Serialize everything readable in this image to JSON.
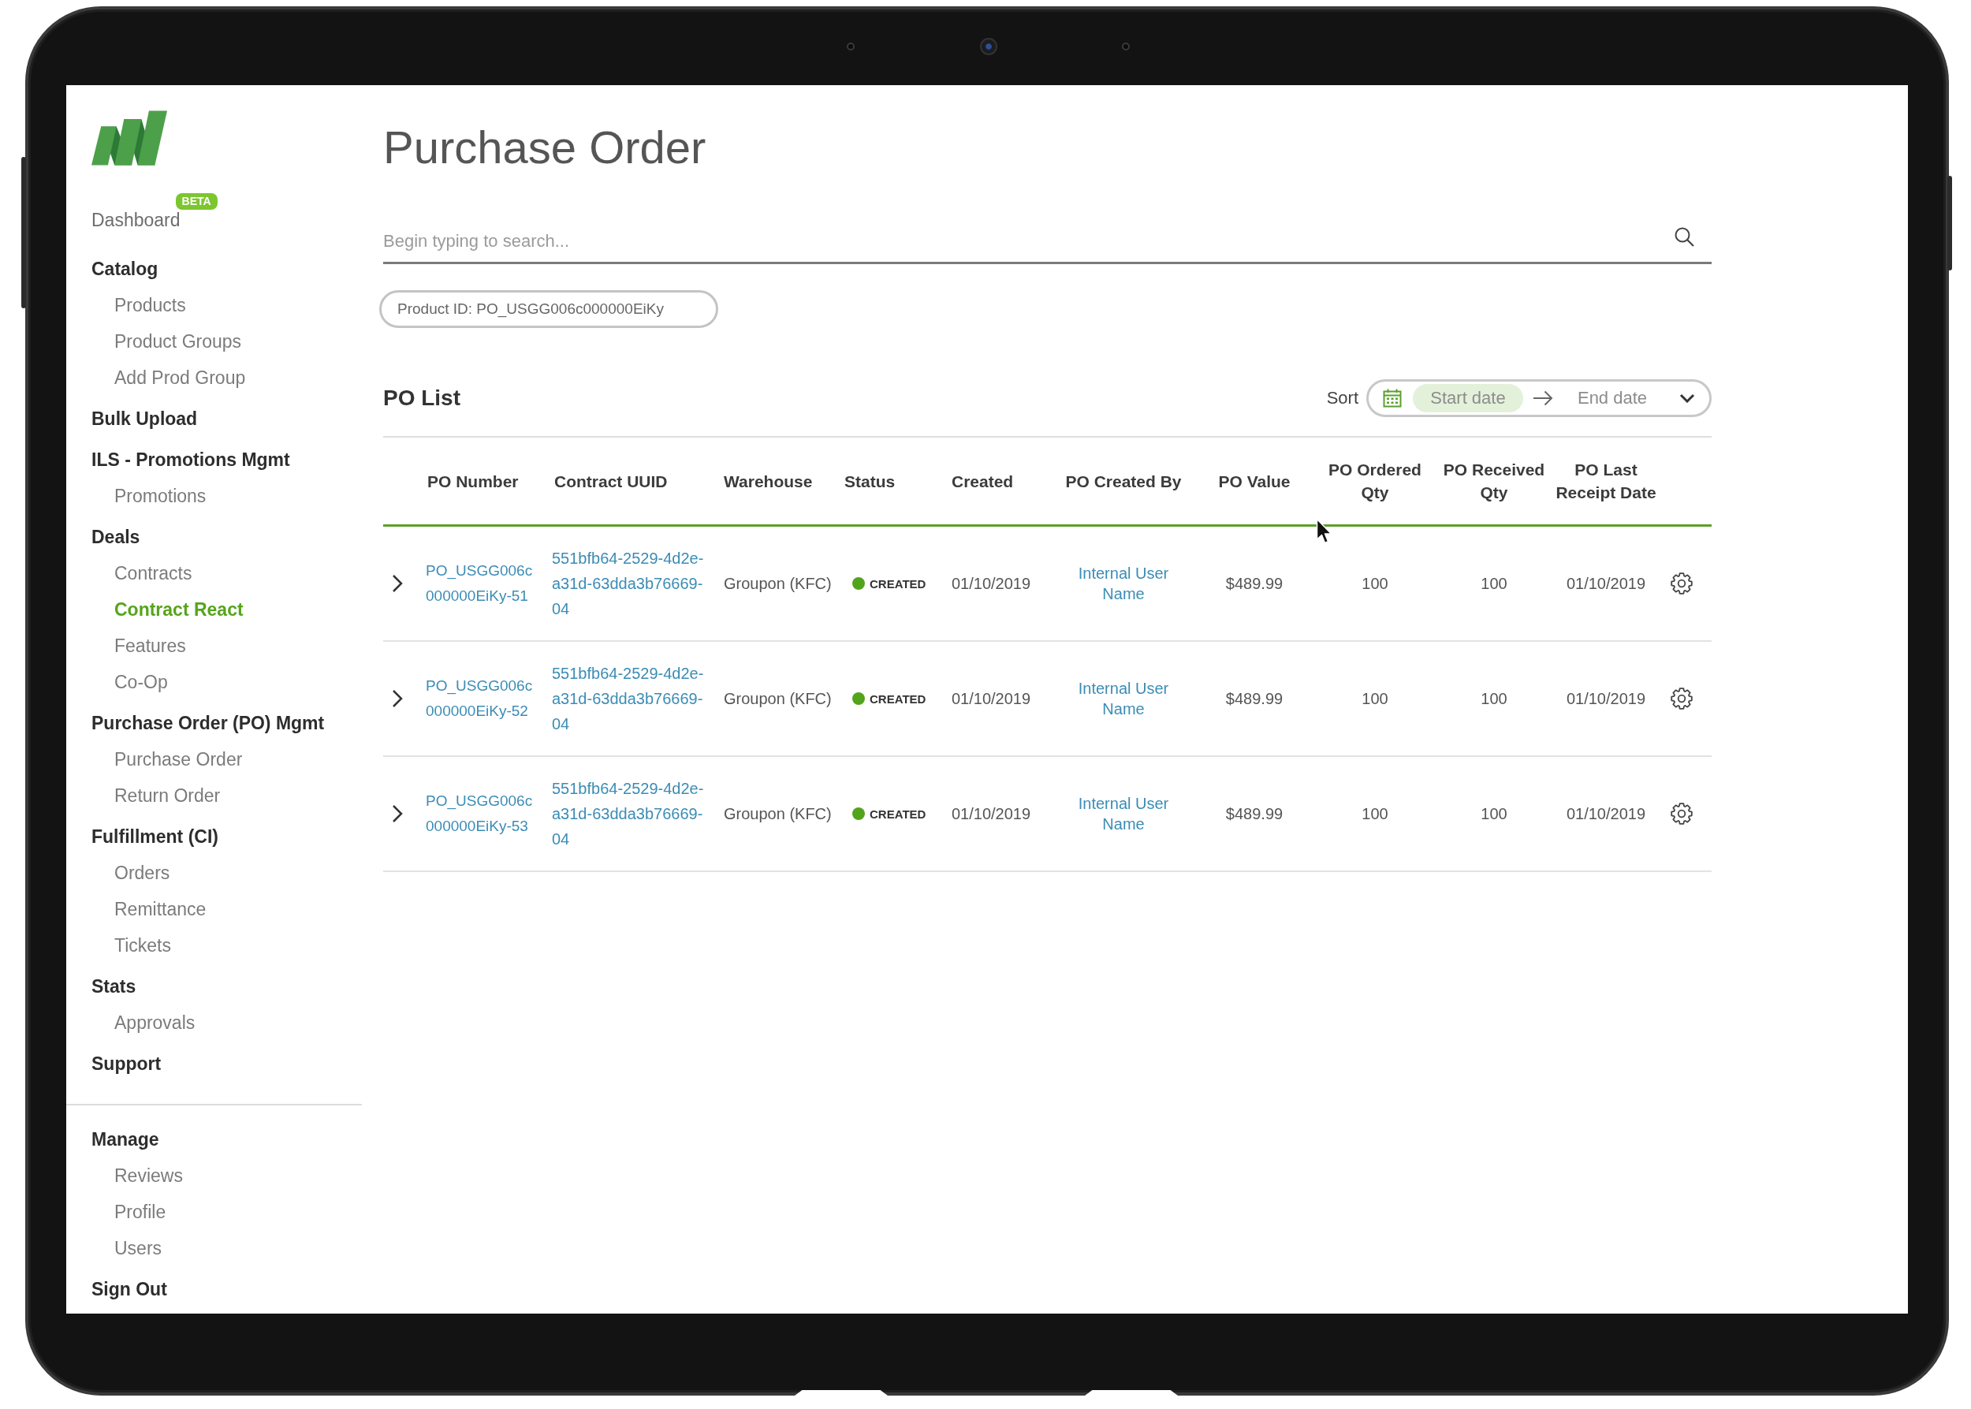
{
  "sidebar": {
    "sections": [
      {
        "items": [
          {
            "kind": "link",
            "label": "Dashboard",
            "badge": "BETA",
            "selected": false
          },
          {
            "kind": "group",
            "label": "Catalog",
            "selected": false,
            "children": [
              {
                "label": "Products",
                "selected": false
              },
              {
                "label": "Product Groups",
                "selected": false
              },
              {
                "label": "Add Prod Group",
                "selected": false
              }
            ]
          },
          {
            "kind": "group",
            "label": "Bulk Upload",
            "selected": false
          },
          {
            "kind": "group",
            "label": "ILS - Promotions Mgmt",
            "selected": false,
            "children": [
              {
                "label": "Promotions",
                "selected": false
              }
            ]
          },
          {
            "kind": "group",
            "label": "Deals",
            "selected": false,
            "children": [
              {
                "label": "Contracts",
                "selected": false
              },
              {
                "label": "Contract React",
                "selected": true
              },
              {
                "label": "Features",
                "selected": false
              },
              {
                "label": "Co-Op",
                "selected": false
              }
            ]
          },
          {
            "kind": "group",
            "label": "Purchase Order (PO) Mgmt",
            "selected": false,
            "children": [
              {
                "label": "Purchase Order",
                "selected": false
              },
              {
                "label": "Return Order",
                "selected": false
              }
            ]
          },
          {
            "kind": "group",
            "label": "Fulfillment (CI)",
            "selected": false,
            "children": [
              {
                "label": "Orders",
                "selected": false
              },
              {
                "label": "Remittance",
                "selected": false
              },
              {
                "label": "Tickets",
                "selected": false
              }
            ]
          },
          {
            "kind": "group",
            "label": "Stats",
            "selected": false,
            "children": [
              {
                "label": "Approvals",
                "selected": false
              }
            ]
          },
          {
            "kind": "group",
            "label": "Support",
            "selected": false
          }
        ]
      },
      {
        "items": [
          {
            "kind": "group",
            "label": "Manage",
            "selected": false,
            "children": [
              {
                "label": "Reviews",
                "selected": false
              },
              {
                "label": "Profile",
                "selected": false
              },
              {
                "label": "Users",
                "selected": false
              }
            ]
          },
          {
            "kind": "group",
            "label": "Sign Out",
            "selected": false
          }
        ]
      }
    ]
  },
  "page": {
    "title": "Purchase Order"
  },
  "search": {
    "placeholder": "Begin typing to search..."
  },
  "filters": [
    {
      "label": "Product ID: PO_USGG006c000000EiKy"
    }
  ],
  "po_list": {
    "title": "PO List",
    "sort": {
      "label": "Sort",
      "start_date": {
        "placeholder": "Start date",
        "selected": true
      },
      "end_date": {
        "placeholder": "End date",
        "selected": false
      }
    }
  },
  "table": {
    "columns": [
      "PO Number",
      "Contract UUID",
      "Warehouse",
      "Status",
      "Created",
      "PO Created By",
      "PO Value",
      "PO Ordered Qty",
      "PO Received Qty",
      "PO Last Receipt Date"
    ],
    "rows": [
      {
        "expanded": false,
        "po_number": "PO_USGG006c000000EiKy-51",
        "contract_uuid": "551bfb64-2529-4d2e-a31d-63dda3b76669-04",
        "warehouse": "Groupon (KFC)",
        "status": {
          "label": "CREATED",
          "color": "#52a41c"
        },
        "created": "01/10/2019",
        "created_by": "Internal User Name",
        "po_value": "$489.99",
        "ordered_qty": "100",
        "received_qty": "100",
        "last_receipt_date": "01/10/2019"
      },
      {
        "expanded": false,
        "po_number": "PO_USGG006c000000EiKy-52",
        "contract_uuid": "551bfb64-2529-4d2e-a31d-63dda3b76669-04",
        "warehouse": "Groupon (KFC)",
        "status": {
          "label": "CREATED",
          "color": "#52a41c"
        },
        "created": "01/10/2019",
        "created_by": "Internal User Name",
        "po_value": "$489.99",
        "ordered_qty": "100",
        "received_qty": "100",
        "last_receipt_date": "01/10/2019"
      },
      {
        "expanded": false,
        "po_number": "PO_USGG006c000000EiKy-53",
        "contract_uuid": "551bfb64-2529-4d2e-a31d-63dda3b76669-04",
        "warehouse": "Groupon (KFC)",
        "status": {
          "label": "CREATED",
          "color": "#52a41c"
        },
        "created": "01/10/2019",
        "created_by": "Internal User Name",
        "po_value": "$489.99",
        "ordered_qty": "100",
        "received_qty": "100",
        "last_receipt_date": "01/10/2019"
      }
    ]
  }
}
